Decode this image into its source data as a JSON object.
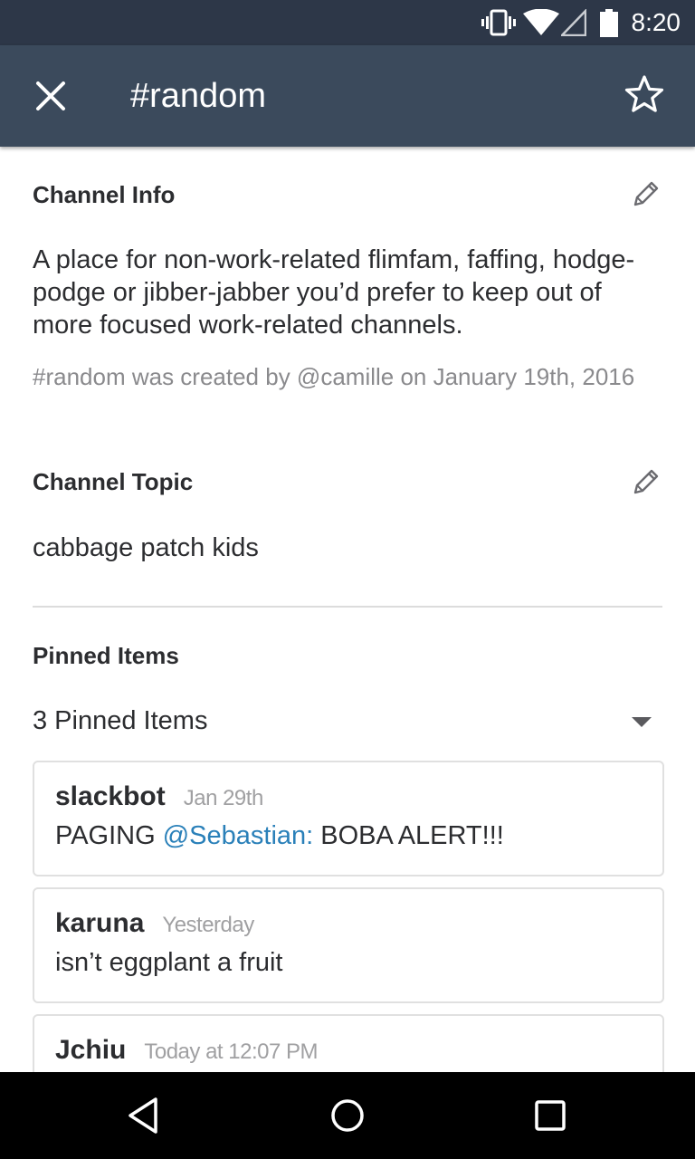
{
  "status_bar": {
    "time": "8:20",
    "icons": [
      "vibrate-icon",
      "wifi-icon",
      "signal-icon",
      "battery-icon"
    ]
  },
  "app_bar": {
    "title": "#random",
    "close_icon": "close-icon",
    "star_icon": "star-outline-icon",
    "color": "#3b4a5c"
  },
  "channel_info": {
    "heading": "Channel Info",
    "purpose": "A place for non-work-related flimfam, faffing, hodge-podge or jibber-jabber you’d prefer to keep out of more focused work-related channels.",
    "created": "#random was created by @camille on January 19th, 2016"
  },
  "channel_topic": {
    "heading": "Channel Topic",
    "text": "cabbage patch kids"
  },
  "pinned": {
    "heading": "Pinned Items",
    "summary": "3 Pinned Items",
    "items": [
      {
        "author": "slackbot",
        "time": "Jan 29th",
        "text_before": "PAGING ",
        "mention": "@Sebastian:",
        "text_after": " BOBA ALERT!!!"
      },
      {
        "author": "karuna",
        "time": "Yesterday",
        "text_before": "isn’t eggplant a fruit",
        "mention": "",
        "text_after": ""
      },
      {
        "author": "Jchiu",
        "time": "Today at 12:07 PM",
        "text_before": "",
        "mention": "",
        "text_after": ""
      }
    ]
  },
  "mention_color": "#2a80b9",
  "nav_bar": {
    "icons": [
      "back-icon",
      "home-icon",
      "recents-icon"
    ]
  }
}
